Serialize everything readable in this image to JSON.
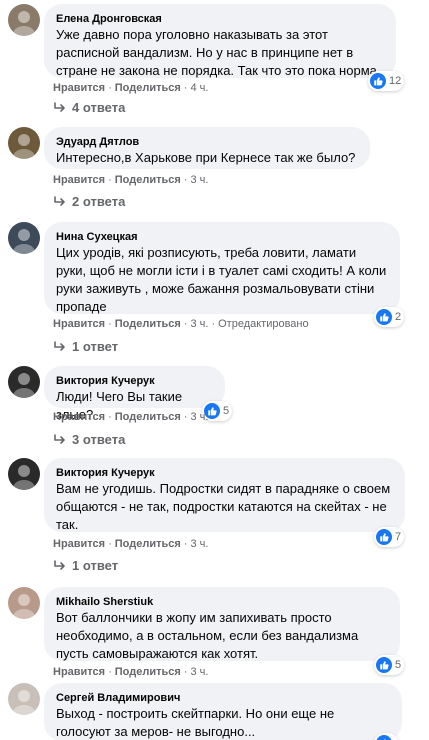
{
  "labels": {
    "like": "Нравится",
    "share": "Поделиться",
    "dot": "·"
  },
  "comments": [
    {
      "author": "Елена Дронговская",
      "text": "Уже давно пора уголовно наказывать за этот расписной вандализм. Но у нас в принципе нет в стране не закона не порядка. Так что это пока норма.",
      "time": "4 ч.",
      "edited": "",
      "reaction_count": "12",
      "replies": "4 ответа",
      "avatar_color": "#8a7a6a"
    },
    {
      "author": "Эдуард Дятлов",
      "text": "Интересно,в Харькове при Кернесе так же было?",
      "time": "3 ч.",
      "edited": "",
      "reaction_count": "",
      "replies": "2 ответа",
      "avatar_color": "#6d5a3a"
    },
    {
      "author": "Нина Сухецкая",
      "text": "Цих уродів, які розписують, треба ловити, ламати руки, щоб не могли істи і в туалет самі сходить! А коли руки заживуть , може бажання розмальовувати стіни пропаде",
      "time": "3 ч.",
      "edited": "Отредактировано",
      "reaction_count": "2",
      "replies": "1 ответ",
      "avatar_color": "#3c4a5a"
    },
    {
      "author": "Виктория Кучерук",
      "text": "Люди! Чего Вы такие злые?",
      "time": "3 ч.",
      "edited": "",
      "reaction_count": "5",
      "replies": "3 ответа",
      "avatar_color": "#2a2a2a"
    },
    {
      "author": "Виктория Кучерук",
      "text": "Вам не угодишь. Подростки сидят в парадняке о своем общаются - не так, подростки катаются на скейтах - не так.",
      "time": "3 ч.",
      "edited": "",
      "reaction_count": "7",
      "replies": "1 ответ",
      "avatar_color": "#2a2a2a"
    },
    {
      "author": "Mikhailo Sherstiuk",
      "text": "Вот баллончики в жопу им запихивать просто необходимо, а в остальном, если без вандализма пусть самовыражаются как хотят.",
      "time": "3 ч.",
      "edited": "",
      "reaction_count": "5",
      "replies": "",
      "avatar_color": "#b89a8a"
    },
    {
      "author": "Сергей Владимирович",
      "text": "Выход - построить скейтпарки. Но они еще не голосуют за меров- не выгодно...",
      "time": "",
      "edited": "",
      "reaction_count": "",
      "replies": "",
      "avatar_color": "#c8c0b8"
    }
  ]
}
